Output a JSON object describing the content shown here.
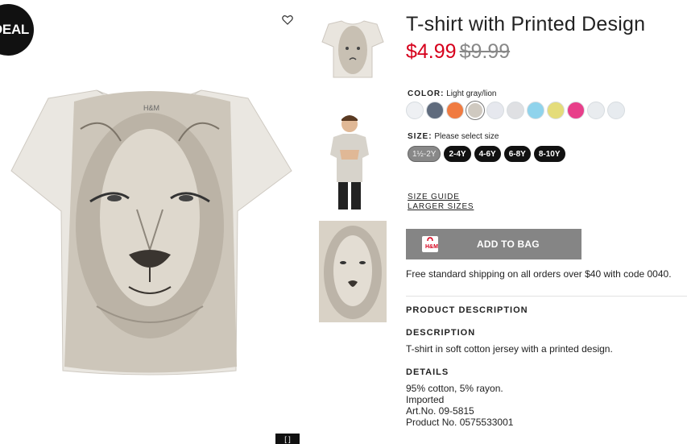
{
  "badge": {
    "deal_text": "DEAL"
  },
  "icons": {
    "favorite": "heart-outline-icon",
    "zoom": "zoom-icon",
    "bag": "shopping-bag-icon"
  },
  "product": {
    "title": "T-shirt with Printed Design",
    "price_current": "$4.99",
    "price_original": "$9.99"
  },
  "color": {
    "label": "COLOR:",
    "selected_name": "Light gray/lion",
    "swatches": [
      "#eef0f3",
      "#5f6b7d",
      "#f07b41",
      "#cfc9c0",
      "#e6e8ee",
      "#dfe0e3",
      "#8fd3ec",
      "#e4dc7a",
      "#e83f8a",
      "#e9ecef",
      "#e7ebef"
    ]
  },
  "size": {
    "label": "SIZE:",
    "prompt": "Please select size",
    "options": [
      "1½-2Y",
      "2-4Y",
      "4-6Y",
      "6-8Y",
      "8-10Y"
    ]
  },
  "links": {
    "size_guide": "SIZE GUIDE",
    "larger_sizes": "LARGER SIZES"
  },
  "cart": {
    "add_label": "ADD TO BAG"
  },
  "shipping": {
    "text": "Free standard shipping on all orders over $40 with code 0040."
  },
  "description": {
    "section_heading": "PRODUCT DESCRIPTION",
    "desc_heading": "DESCRIPTION",
    "desc_text": "T-shirt in soft cotton jersey with a printed design.",
    "details_heading": "DETAILS",
    "details": [
      "95% cotton, 5% rayon.",
      "Imported",
      "Art.No. 09-5815",
      "Product No. 0575533001"
    ]
  },
  "colors": {
    "price_red": "#d6001c",
    "button_gray": "#858585",
    "size_black": "#111111"
  }
}
